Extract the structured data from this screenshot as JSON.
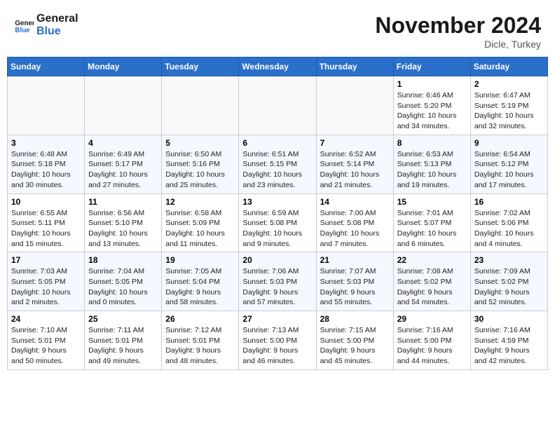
{
  "header": {
    "logo_line1": "General",
    "logo_line2": "Blue",
    "month_year": "November 2024",
    "location": "Dicle, Turkey"
  },
  "weekdays": [
    "Sunday",
    "Monday",
    "Tuesday",
    "Wednesday",
    "Thursday",
    "Friday",
    "Saturday"
  ],
  "weeks": [
    [
      {
        "day": "",
        "info": ""
      },
      {
        "day": "",
        "info": ""
      },
      {
        "day": "",
        "info": ""
      },
      {
        "day": "",
        "info": ""
      },
      {
        "day": "",
        "info": ""
      },
      {
        "day": "1",
        "info": "Sunrise: 6:46 AM\nSunset: 5:20 PM\nDaylight: 10 hours\nand 34 minutes."
      },
      {
        "day": "2",
        "info": "Sunrise: 6:47 AM\nSunset: 5:19 PM\nDaylight: 10 hours\nand 32 minutes."
      }
    ],
    [
      {
        "day": "3",
        "info": "Sunrise: 6:48 AM\nSunset: 5:18 PM\nDaylight: 10 hours\nand 30 minutes."
      },
      {
        "day": "4",
        "info": "Sunrise: 6:49 AM\nSunset: 5:17 PM\nDaylight: 10 hours\nand 27 minutes."
      },
      {
        "day": "5",
        "info": "Sunrise: 6:50 AM\nSunset: 5:16 PM\nDaylight: 10 hours\nand 25 minutes."
      },
      {
        "day": "6",
        "info": "Sunrise: 6:51 AM\nSunset: 5:15 PM\nDaylight: 10 hours\nand 23 minutes."
      },
      {
        "day": "7",
        "info": "Sunrise: 6:52 AM\nSunset: 5:14 PM\nDaylight: 10 hours\nand 21 minutes."
      },
      {
        "day": "8",
        "info": "Sunrise: 6:53 AM\nSunset: 5:13 PM\nDaylight: 10 hours\nand 19 minutes."
      },
      {
        "day": "9",
        "info": "Sunrise: 6:54 AM\nSunset: 5:12 PM\nDaylight: 10 hours\nand 17 minutes."
      }
    ],
    [
      {
        "day": "10",
        "info": "Sunrise: 6:55 AM\nSunset: 5:11 PM\nDaylight: 10 hours\nand 15 minutes."
      },
      {
        "day": "11",
        "info": "Sunrise: 6:56 AM\nSunset: 5:10 PM\nDaylight: 10 hours\nand 13 minutes."
      },
      {
        "day": "12",
        "info": "Sunrise: 6:58 AM\nSunset: 5:09 PM\nDaylight: 10 hours\nand 11 minutes."
      },
      {
        "day": "13",
        "info": "Sunrise: 6:59 AM\nSunset: 5:08 PM\nDaylight: 10 hours\nand 9 minutes."
      },
      {
        "day": "14",
        "info": "Sunrise: 7:00 AM\nSunset: 5:08 PM\nDaylight: 10 hours\nand 7 minutes."
      },
      {
        "day": "15",
        "info": "Sunrise: 7:01 AM\nSunset: 5:07 PM\nDaylight: 10 hours\nand 6 minutes."
      },
      {
        "day": "16",
        "info": "Sunrise: 7:02 AM\nSunset: 5:06 PM\nDaylight: 10 hours\nand 4 minutes."
      }
    ],
    [
      {
        "day": "17",
        "info": "Sunrise: 7:03 AM\nSunset: 5:05 PM\nDaylight: 10 hours\nand 2 minutes."
      },
      {
        "day": "18",
        "info": "Sunrise: 7:04 AM\nSunset: 5:05 PM\nDaylight: 10 hours\nand 0 minutes."
      },
      {
        "day": "19",
        "info": "Sunrise: 7:05 AM\nSunset: 5:04 PM\nDaylight: 9 hours\nand 58 minutes."
      },
      {
        "day": "20",
        "info": "Sunrise: 7:06 AM\nSunset: 5:03 PM\nDaylight: 9 hours\nand 57 minutes."
      },
      {
        "day": "21",
        "info": "Sunrise: 7:07 AM\nSunset: 5:03 PM\nDaylight: 9 hours\nand 55 minutes."
      },
      {
        "day": "22",
        "info": "Sunrise: 7:08 AM\nSunset: 5:02 PM\nDaylight: 9 hours\nand 54 minutes."
      },
      {
        "day": "23",
        "info": "Sunrise: 7:09 AM\nSunset: 5:02 PM\nDaylight: 9 hours\nand 52 minutes."
      }
    ],
    [
      {
        "day": "24",
        "info": "Sunrise: 7:10 AM\nSunset: 5:01 PM\nDaylight: 9 hours\nand 50 minutes."
      },
      {
        "day": "25",
        "info": "Sunrise: 7:11 AM\nSunset: 5:01 PM\nDaylight: 9 hours\nand 49 minutes."
      },
      {
        "day": "26",
        "info": "Sunrise: 7:12 AM\nSunset: 5:01 PM\nDaylight: 9 hours\nand 48 minutes."
      },
      {
        "day": "27",
        "info": "Sunrise: 7:13 AM\nSunset: 5:00 PM\nDaylight: 9 hours\nand 46 minutes."
      },
      {
        "day": "28",
        "info": "Sunrise: 7:15 AM\nSunset: 5:00 PM\nDaylight: 9 hours\nand 45 minutes."
      },
      {
        "day": "29",
        "info": "Sunrise: 7:16 AM\nSunset: 5:00 PM\nDaylight: 9 hours\nand 44 minutes."
      },
      {
        "day": "30",
        "info": "Sunrise: 7:16 AM\nSunset: 4:59 PM\nDaylight: 9 hours\nand 42 minutes."
      }
    ]
  ]
}
